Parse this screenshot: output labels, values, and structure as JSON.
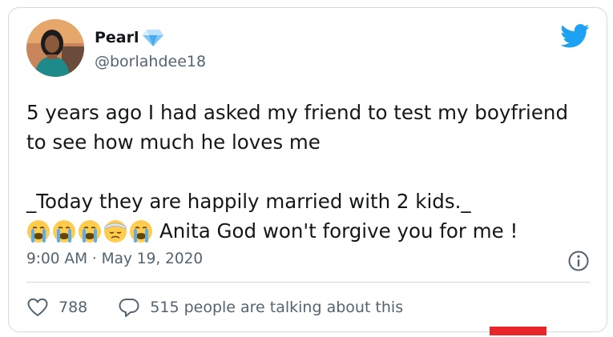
{
  "tweet": {
    "author": {
      "display_name": "Pearl",
      "handle": "@borlahdee18",
      "verified_icon": "blue-diamond",
      "avatar": "profile-photo"
    },
    "brand_icon": "twitter-bird",
    "text_lines": [
      "5 years ago I had asked my friend to test my boyfriend",
      "to see how much he loves me",
      "_Today they are happily married with 2 kids._",
      "Anita God won't forgive you for me !"
    ],
    "emojis": [
      "loudly-crying-face",
      "loudly-crying-face",
      "loudly-crying-face",
      "face-with-head-bandage",
      "loudly-crying-face"
    ],
    "timestamp": "9:00 AM · May 19, 2020",
    "info_icon": "info-circle",
    "like_count": "788",
    "reply_text": "515 people are talking about this"
  },
  "colors": {
    "text": "#14171a",
    "secondary": "#536471",
    "twitter_blue": "#1da1f2",
    "border": "#cfd9de",
    "marker_red": "#e8262a"
  }
}
